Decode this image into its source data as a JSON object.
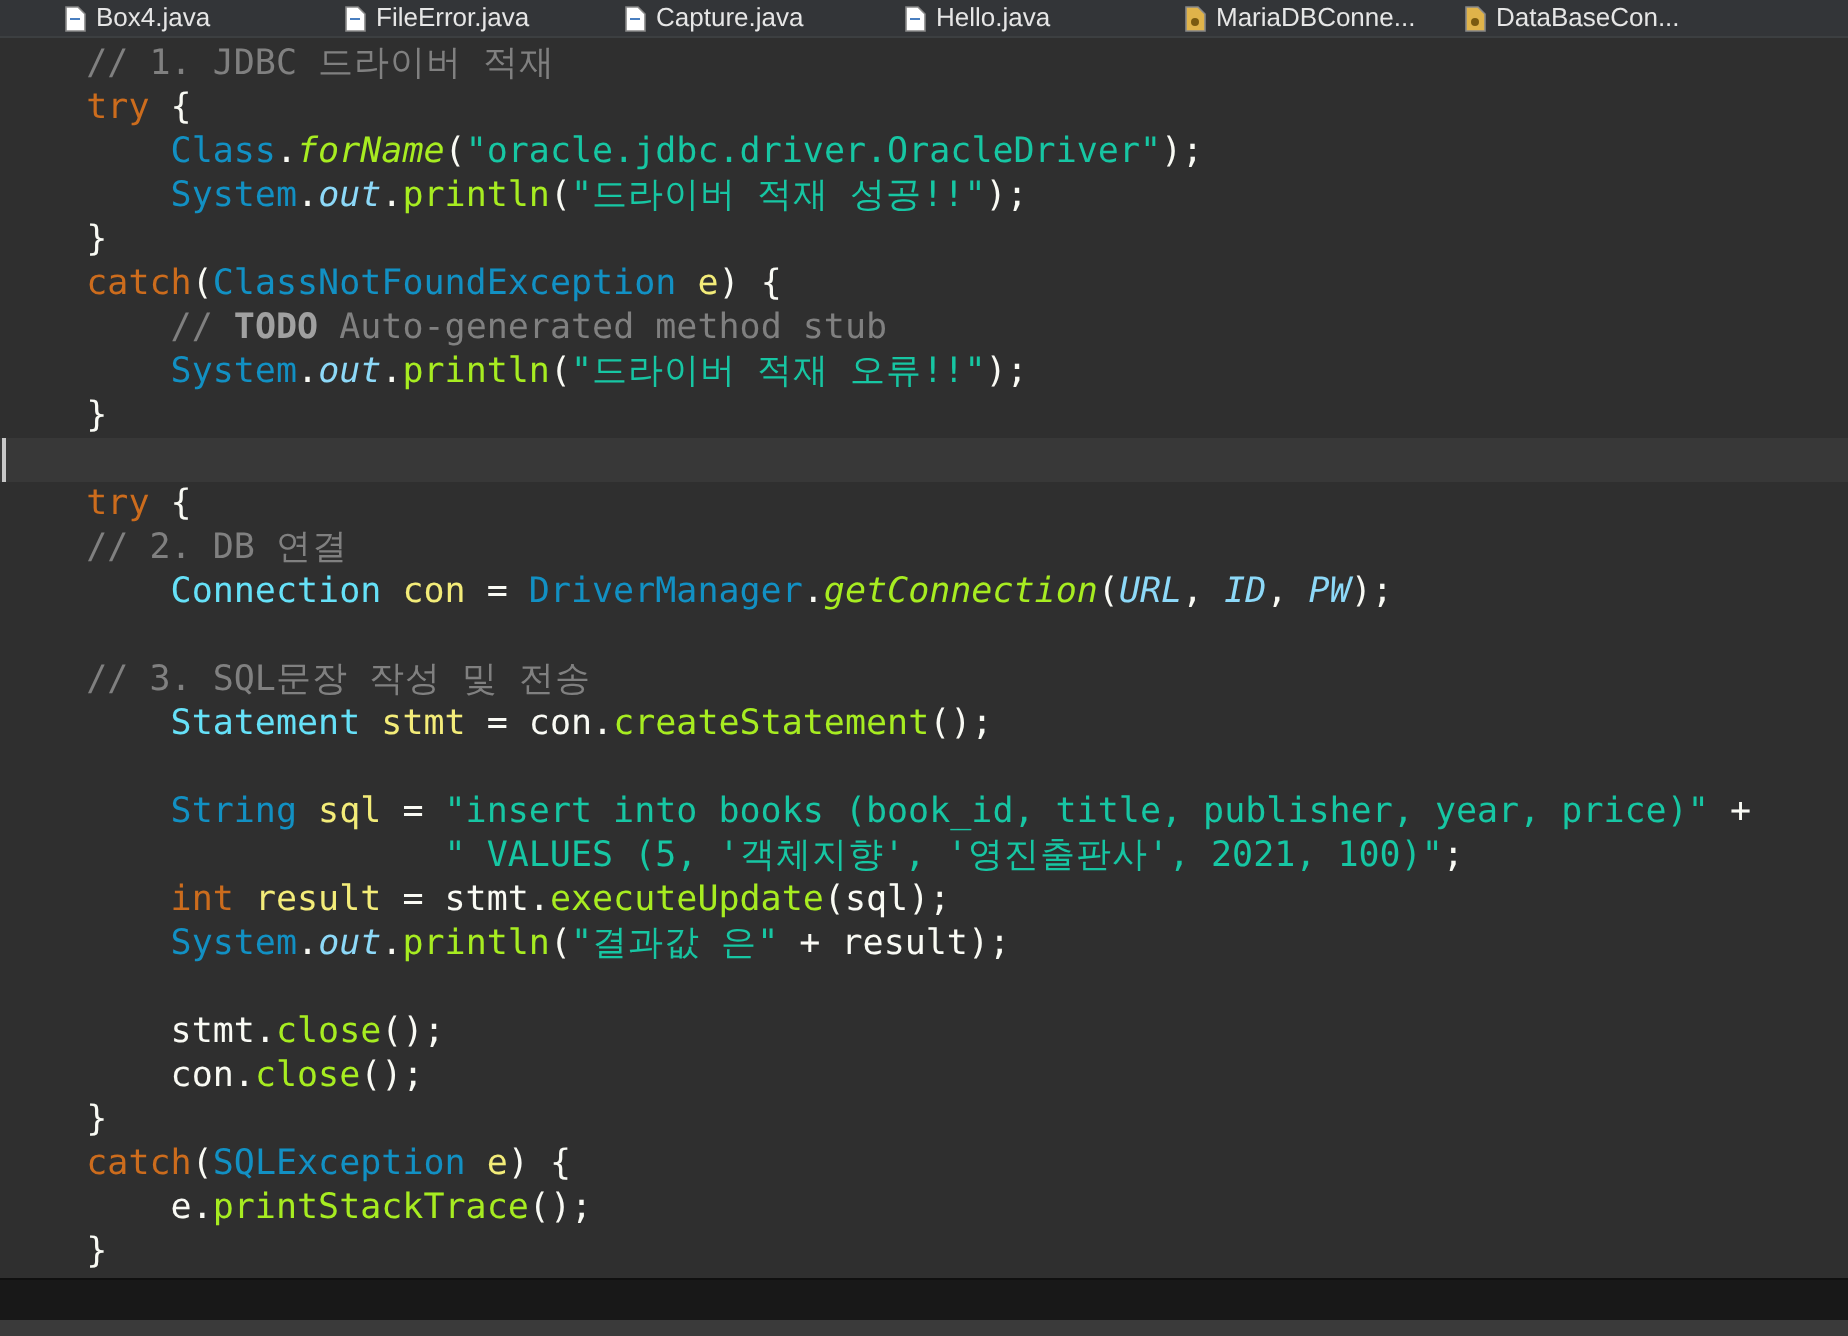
{
  "tabs": [
    {
      "label": "Box4.java",
      "kind": "java"
    },
    {
      "label": "FileError.java",
      "kind": "java"
    },
    {
      "label": "Capture.java",
      "kind": "java"
    },
    {
      "label": "Hello.java",
      "kind": "java"
    },
    {
      "label": "MariaDBConne...",
      "kind": "linked"
    },
    {
      "label": "DataBaseCon...",
      "kind": "linked"
    }
  ],
  "lines": [
    {
      "kind": "code",
      "tokens": [
        {
          "text": "    // 1. JDBC 드라이버 적재",
          "kind": "comment"
        }
      ]
    },
    {
      "kind": "code",
      "tokens": [
        {
          "text": "    try",
          "kind": "keyword"
        },
        {
          "text": " {",
          "kind": "plain"
        }
      ]
    },
    {
      "kind": "code",
      "tokens": [
        {
          "text": "        Class",
          "kind": "type"
        },
        {
          "text": ".",
          "kind": "plain"
        },
        {
          "text": "forName",
          "kind": "static-method"
        },
        {
          "text": "(",
          "kind": "plain"
        },
        {
          "text": "\"oracle.jdbc.driver.OracleDriver\"",
          "kind": "string"
        },
        {
          "text": ");",
          "kind": "plain"
        }
      ]
    },
    {
      "kind": "code",
      "tokens": [
        {
          "text": "        System",
          "kind": "type"
        },
        {
          "text": ".",
          "kind": "plain"
        },
        {
          "text": "out",
          "kind": "field"
        },
        {
          "text": ".",
          "kind": "plain"
        },
        {
          "text": "println",
          "kind": "method"
        },
        {
          "text": "(",
          "kind": "plain"
        },
        {
          "text": "\"드라이버 적재 성공!!\"",
          "kind": "string"
        },
        {
          "text": ");",
          "kind": "plain"
        }
      ]
    },
    {
      "kind": "code",
      "tokens": [
        {
          "text": "    }",
          "kind": "plain"
        }
      ]
    },
    {
      "kind": "code",
      "tokens": [
        {
          "text": "    catch",
          "kind": "keyword"
        },
        {
          "text": "(",
          "kind": "plain"
        },
        {
          "text": "ClassNotFoundException ",
          "kind": "type"
        },
        {
          "text": "e",
          "kind": "variable"
        },
        {
          "text": ") {",
          "kind": "plain"
        }
      ]
    },
    {
      "kind": "code",
      "tokens": [
        {
          "text": "        // ",
          "kind": "comment"
        },
        {
          "text": "TODO",
          "kind": "todo"
        },
        {
          "text": " Auto-generated method stub",
          "kind": "comment"
        }
      ]
    },
    {
      "kind": "code",
      "tokens": [
        {
          "text": "        System",
          "kind": "type"
        },
        {
          "text": ".",
          "kind": "plain"
        },
        {
          "text": "out",
          "kind": "field"
        },
        {
          "text": ".",
          "kind": "plain"
        },
        {
          "text": "println",
          "kind": "method"
        },
        {
          "text": "(",
          "kind": "plain"
        },
        {
          "text": "\"드라이버 적재 오류!!\"",
          "kind": "string"
        },
        {
          "text": ");",
          "kind": "plain"
        }
      ]
    },
    {
      "kind": "code",
      "tokens": [
        {
          "text": "    }",
          "kind": "plain"
        }
      ]
    },
    {
      "kind": "current"
    },
    {
      "kind": "code",
      "tokens": [
        {
          "text": "    try",
          "kind": "keyword"
        },
        {
          "text": " {",
          "kind": "plain"
        }
      ]
    },
    {
      "kind": "code",
      "tokens": [
        {
          "text": "    // 2. DB 연결",
          "kind": "comment"
        }
      ]
    },
    {
      "kind": "code",
      "tokens": [
        {
          "text": "        Connection ",
          "kind": "class"
        },
        {
          "text": "con",
          "kind": "variable"
        },
        {
          "text": " = ",
          "kind": "plain"
        },
        {
          "text": "DriverManager",
          "kind": "type"
        },
        {
          "text": ".",
          "kind": "plain"
        },
        {
          "text": "getConnection",
          "kind": "static-method"
        },
        {
          "text": "(",
          "kind": "plain"
        },
        {
          "text": "URL",
          "kind": "constant"
        },
        {
          "text": ", ",
          "kind": "plain"
        },
        {
          "text": "ID",
          "kind": "constant"
        },
        {
          "text": ", ",
          "kind": "plain"
        },
        {
          "text": "PW",
          "kind": "constant"
        },
        {
          "text": ");",
          "kind": "plain"
        }
      ]
    },
    {
      "kind": "blank"
    },
    {
      "kind": "code",
      "tokens": [
        {
          "text": "    // 3. SQL문장 작성 및 전송",
          "kind": "comment"
        }
      ]
    },
    {
      "kind": "code",
      "tokens": [
        {
          "text": "        Statement ",
          "kind": "class"
        },
        {
          "text": "stmt",
          "kind": "variable"
        },
        {
          "text": " = con.",
          "kind": "plain"
        },
        {
          "text": "createStatement",
          "kind": "method"
        },
        {
          "text": "();",
          "kind": "plain"
        }
      ]
    },
    {
      "kind": "blank"
    },
    {
      "kind": "code",
      "tokens": [
        {
          "text": "        String ",
          "kind": "type"
        },
        {
          "text": "sql",
          "kind": "variable"
        },
        {
          "text": " = ",
          "kind": "plain"
        },
        {
          "text": "\"insert into books (book_id, title, publisher, year, price)\"",
          "kind": "string"
        },
        {
          "text": " +",
          "kind": "plain"
        }
      ]
    },
    {
      "kind": "code",
      "tokens": [
        {
          "text": "                     \" VALUES (5, '객체지향', '영진출판사', 2021, 100)\"",
          "kind": "string"
        },
        {
          "text": ";",
          "kind": "plain"
        }
      ]
    },
    {
      "kind": "code",
      "tokens": [
        {
          "text": "        int ",
          "kind": "keyword"
        },
        {
          "text": "result",
          "kind": "variable"
        },
        {
          "text": " = stmt.",
          "kind": "plain"
        },
        {
          "text": "executeUpdate",
          "kind": "method"
        },
        {
          "text": "(sql);",
          "kind": "plain"
        }
      ]
    },
    {
      "kind": "code",
      "tokens": [
        {
          "text": "        System",
          "kind": "type"
        },
        {
          "text": ".",
          "kind": "plain"
        },
        {
          "text": "out",
          "kind": "field"
        },
        {
          "text": ".",
          "kind": "plain"
        },
        {
          "text": "println",
          "kind": "method"
        },
        {
          "text": "(",
          "kind": "plain"
        },
        {
          "text": "\"결과값 은\"",
          "kind": "string"
        },
        {
          "text": " + result);",
          "kind": "plain"
        }
      ]
    },
    {
      "kind": "blank"
    },
    {
      "kind": "code",
      "tokens": [
        {
          "text": "        stmt.",
          "kind": "plain"
        },
        {
          "text": "close",
          "kind": "method"
        },
        {
          "text": "();",
          "kind": "plain"
        }
      ]
    },
    {
      "kind": "code",
      "tokens": [
        {
          "text": "        con.",
          "kind": "plain"
        },
        {
          "text": "close",
          "kind": "method"
        },
        {
          "text": "();",
          "kind": "plain"
        }
      ]
    },
    {
      "kind": "code",
      "tokens": [
        {
          "text": "    }",
          "kind": "plain"
        }
      ]
    },
    {
      "kind": "code",
      "tokens": [
        {
          "text": "    catch",
          "kind": "keyword"
        },
        {
          "text": "(",
          "kind": "plain"
        },
        {
          "text": "SQLException ",
          "kind": "type"
        },
        {
          "text": "e",
          "kind": "variable"
        },
        {
          "text": ") {",
          "kind": "plain"
        }
      ]
    },
    {
      "kind": "code",
      "tokens": [
        {
          "text": "        e.",
          "kind": "plain"
        },
        {
          "text": "printStackTrace",
          "kind": "method"
        },
        {
          "text": "();",
          "kind": "plain"
        }
      ]
    },
    {
      "kind": "code",
      "tokens": [
        {
          "text": "    }",
          "kind": "plain"
        }
      ]
    }
  ]
}
